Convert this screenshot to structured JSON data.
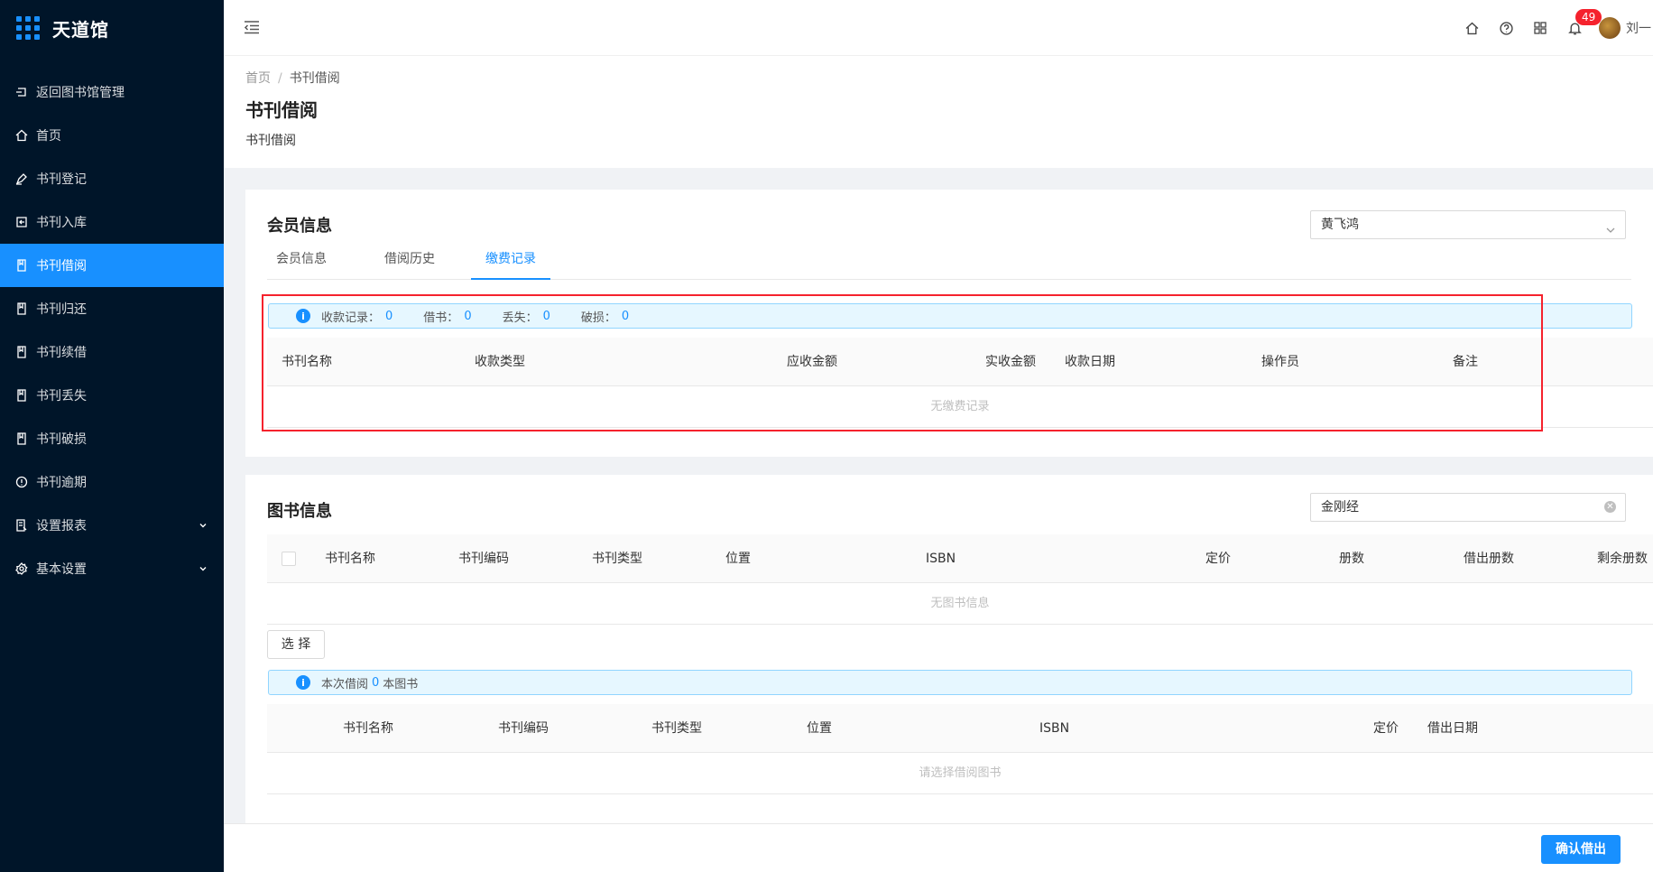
{
  "app": {
    "name": "天道馆"
  },
  "sidebar": {
    "items": [
      {
        "label": "返回图书馆管理",
        "icon": "back-icon"
      },
      {
        "label": "首页",
        "icon": "home-icon"
      },
      {
        "label": "书刊登记",
        "icon": "pen-icon"
      },
      {
        "label": "书刊入库",
        "icon": "import-icon"
      },
      {
        "label": "书刊借阅",
        "icon": "book-icon",
        "active": true
      },
      {
        "label": "书刊归还",
        "icon": "book-icon"
      },
      {
        "label": "书刊续借",
        "icon": "book-icon"
      },
      {
        "label": "书刊丢失",
        "icon": "book-icon"
      },
      {
        "label": "书刊破损",
        "icon": "book-icon"
      },
      {
        "label": "书刊逾期",
        "icon": "alert-circle-icon"
      },
      {
        "label": "设置报表",
        "icon": "report-icon"
      },
      {
        "label": "基本设置",
        "icon": "gear-icon"
      }
    ]
  },
  "header": {
    "notification_count": "49",
    "user_name": "刘一"
  },
  "breadcrumb": {
    "home": "首页",
    "current": "书刊借阅"
  },
  "page": {
    "title": "书刊借阅",
    "description": "书刊借阅"
  },
  "member": {
    "title": "会员信息",
    "selected_member": "黄飞鸿",
    "tabs": [
      "会员信息",
      "借阅历史",
      "缴费记录"
    ],
    "active_tab": 2,
    "summary": [
      {
        "label": "收款记录：",
        "value": "0"
      },
      {
        "label": "借书：",
        "value": "0"
      },
      {
        "label": "丢失：",
        "value": "0"
      },
      {
        "label": "破损：",
        "value": "0"
      }
    ],
    "columns": [
      "书刊名称",
      "收款类型",
      "应收金额",
      "实收金额",
      "收款日期",
      "操作员",
      "备注"
    ],
    "empty_text": "无缴费记录"
  },
  "books": {
    "title": "图书信息",
    "search_value": "金刚经",
    "columns": [
      "书刊名称",
      "书刊编码",
      "书刊类型",
      "位置",
      "ISBN",
      "定价",
      "册数",
      "借出册数",
      "剩余册数"
    ],
    "empty_text": "无图书信息",
    "select_button": "选 择",
    "borrow_prefix": "本次借阅",
    "borrow_count": "0",
    "borrow_suffix": "本图书",
    "borrow_columns": [
      "书刊名称",
      "书刊编码",
      "书刊类型",
      "位置",
      "ISBN",
      "定价",
      "借出日期"
    ],
    "borrow_empty_text": "请选择借阅图书"
  },
  "footer": {
    "confirm_button": "确认借出"
  },
  "colors": {
    "sidebar_bg": "#001529",
    "accent": "#1890ff",
    "highlight_box": "#f5222d"
  }
}
